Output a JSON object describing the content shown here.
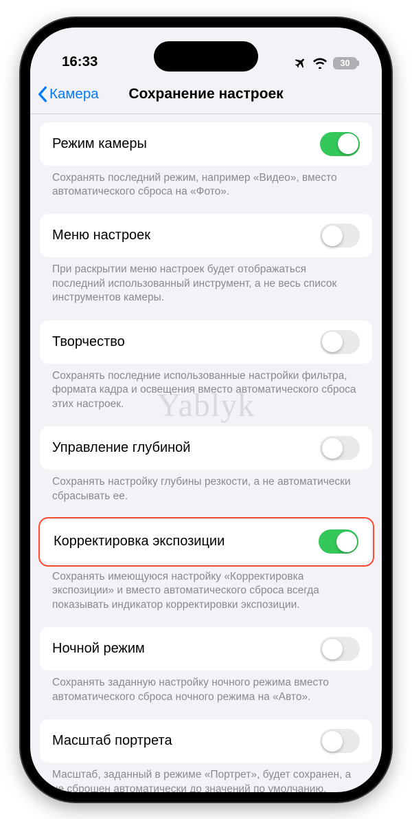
{
  "status": {
    "time": "16:33",
    "battery": "30"
  },
  "nav": {
    "back": "Камера",
    "title": "Сохранение настроек"
  },
  "settings": [
    {
      "key": "camera-mode",
      "label": "Режим камеры",
      "on": true,
      "highlighted": false,
      "footer": "Сохранять последний режим, например «Видео», вместо автоматического сброса на «Фото»."
    },
    {
      "key": "controls-menu",
      "label": "Меню настроек",
      "on": false,
      "highlighted": false,
      "footer": "При раскрытии меню настроек будет отображаться последний использованный инструмент, а не весь список инструментов камеры."
    },
    {
      "key": "creative",
      "label": "Творчество",
      "on": false,
      "highlighted": false,
      "footer": "Сохранять последние использованные настройки фильтра, формата кадра и освещения вместо автоматического сброса этих настроек."
    },
    {
      "key": "depth-control",
      "label": "Управление глубиной",
      "on": false,
      "highlighted": false,
      "footer": "Сохранять настройку глубины резкости, а не автоматически сбрасывать ее."
    },
    {
      "key": "exposure-adjust",
      "label": "Корректировка экспозиции",
      "on": true,
      "highlighted": true,
      "footer": "Сохранять имеющуюся настройку «Корректировка экспозиции» и вместо автоматического сброса всегда показывать индикатор корректировки экспозиции."
    },
    {
      "key": "night-mode",
      "label": "Ночной режим",
      "on": false,
      "highlighted": false,
      "footer": "Сохранять заданную настройку ночного режима вместо автоматического сброса ночного режима на «Авто»."
    },
    {
      "key": "portrait-zoom",
      "label": "Масштаб портрета",
      "on": false,
      "highlighted": false,
      "footer": "Масштаб, заданный в режиме «Портрет», будет сохранен, а не сброшен автоматически до значений по умолчанию."
    }
  ],
  "watermark": "Yablyk"
}
